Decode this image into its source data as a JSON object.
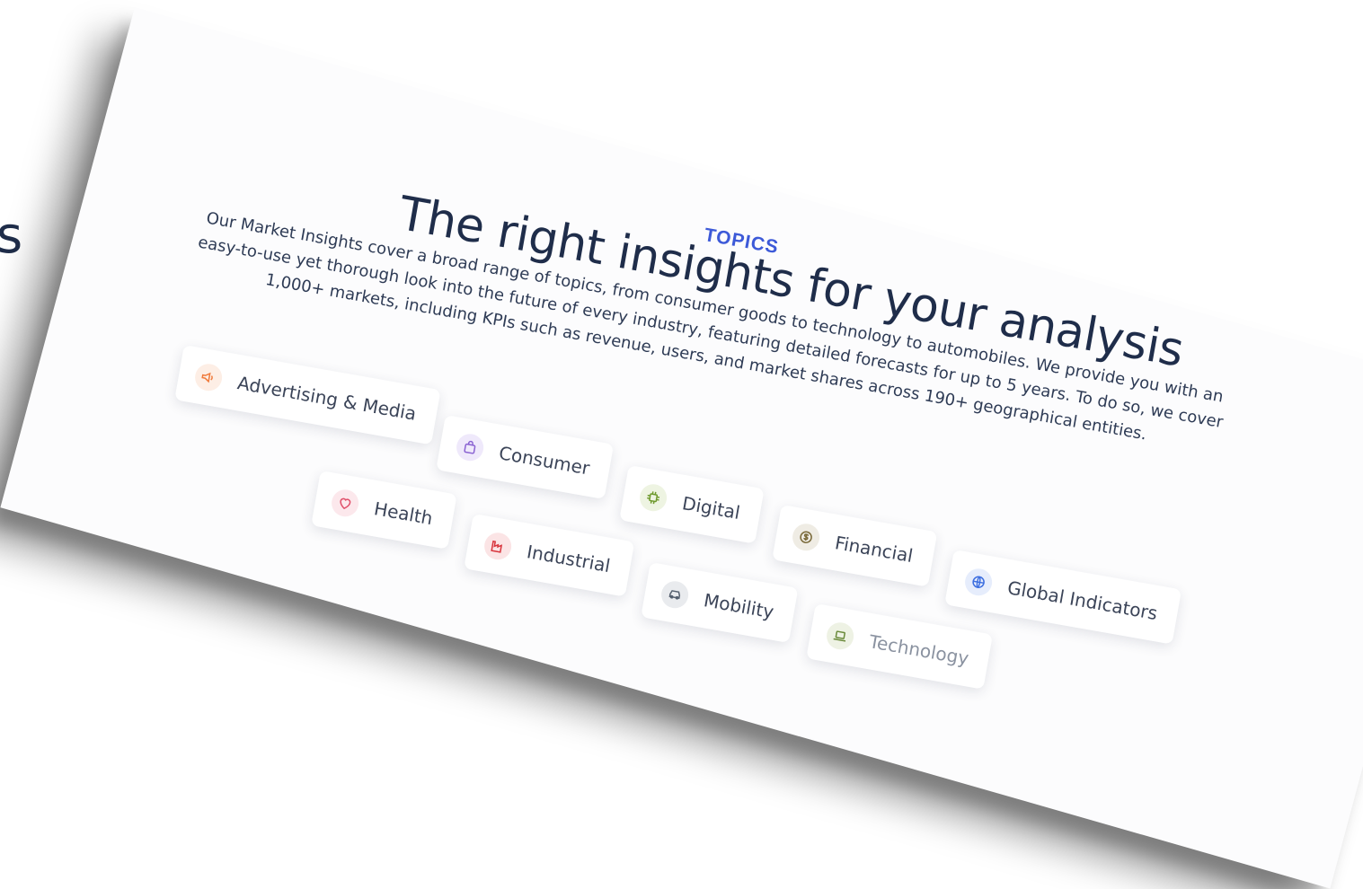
{
  "edge_text": "s",
  "section": {
    "label": "TOPICS",
    "headline": "The right insights for your analysis",
    "description": "Our Market Insights cover a broad range of topics, from consumer goods to technology to automobiles. We provide you with an easy-to-use yet thorough look into the future of every industry, featuring detailed forecasts for up to 5 years. To do so, we cover 1,000+ markets, including KPIs such as revenue, users, and market shares across 190+ geographical entities."
  },
  "topics": [
    {
      "label": "Advertising & Media",
      "icon": "megaphone-icon",
      "color": "#f07a3a",
      "bg": "#fdeee5"
    },
    {
      "label": "Consumer",
      "icon": "shopping-bag-icon",
      "color": "#8a63d2",
      "bg": "#efe9fb"
    },
    {
      "label": "Digital",
      "icon": "chip-icon",
      "color": "#6f9a2e",
      "bg": "#eef4e2"
    },
    {
      "label": "Financial",
      "icon": "coin-icon",
      "color": "#7a6a3a",
      "bg": "#efece4"
    },
    {
      "label": "Global Indicators",
      "icon": "globe-icon",
      "color": "#3d6fe0",
      "bg": "#e6edfc"
    },
    {
      "label": "Health",
      "icon": "heart-icon",
      "color": "#e0506a",
      "bg": "#fce8ec"
    },
    {
      "label": "Industrial",
      "icon": "factory-icon",
      "color": "#d8343c",
      "bg": "#fbe4e5"
    },
    {
      "label": "Mobility",
      "icon": "car-icon",
      "color": "#55606f",
      "bg": "#e9ebee"
    },
    {
      "label": "Technology",
      "icon": "laptop-icon",
      "color": "#6a8a3a",
      "bg": "#eef2e4"
    }
  ]
}
